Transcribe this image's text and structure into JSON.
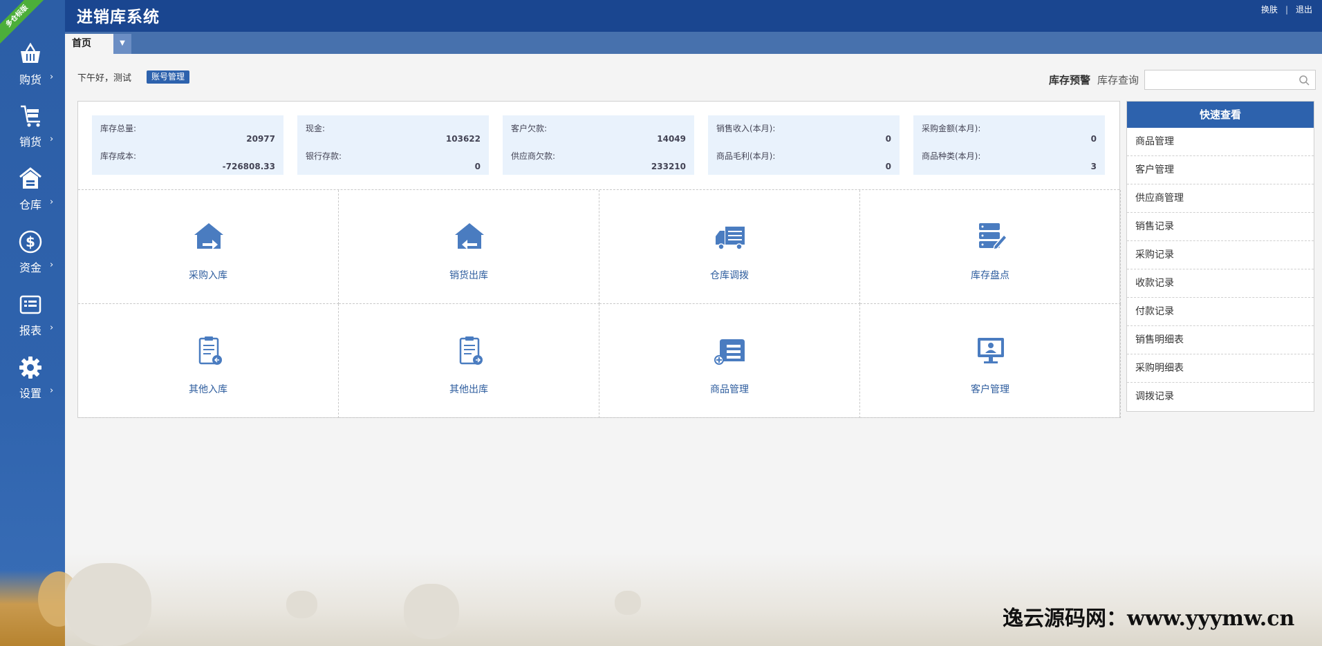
{
  "header": {
    "title": "进销库系统",
    "links": [
      "换肤",
      "退出"
    ]
  },
  "corner_badge": "多仓标版",
  "sidebar": {
    "items": [
      {
        "label": "购货",
        "icon": "basket-icon"
      },
      {
        "label": "销货",
        "icon": "cart-icon"
      },
      {
        "label": "仓库",
        "icon": "warehouse-icon"
      },
      {
        "label": "资金",
        "icon": "dollar-icon"
      },
      {
        "label": "报表",
        "icon": "report-icon"
      },
      {
        "label": "设置",
        "icon": "gear-icon"
      }
    ],
    "chevron": "›"
  },
  "tabs": {
    "home": "首页",
    "dropdown": "▼"
  },
  "greeting": {
    "text": "下午好，测试",
    "account_button": "账号管理"
  },
  "toolbar": {
    "stock_warning": "库存预警",
    "stock_query": "库存查询",
    "search_value": ""
  },
  "stats": [
    {
      "k1": "库存总量:",
      "v1": "20977",
      "k2": "库存成本:",
      "v2": "-726808.33"
    },
    {
      "k1": "现金:",
      "v1": "103622",
      "k2": "银行存款:",
      "v2": "0"
    },
    {
      "k1": "客户欠款:",
      "v1": "14049",
      "k2": "供应商欠款:",
      "v2": "233210"
    },
    {
      "k1": "销售收入(本月):",
      "v1": "0",
      "k2": "商品毛利(本月):",
      "v2": "0"
    },
    {
      "k1": "采购金额(本月):",
      "v1": "0",
      "k2": "商品种类(本月):",
      "v2": "3"
    }
  ],
  "shortcuts": [
    {
      "label": "采购入库",
      "icon": "purchase-in-icon"
    },
    {
      "label": "销货出库",
      "icon": "sales-out-icon"
    },
    {
      "label": "仓库调拨",
      "icon": "truck-icon"
    },
    {
      "label": "库存盘点",
      "icon": "inventory-check-icon"
    },
    {
      "label": "其他入库",
      "icon": "other-in-icon"
    },
    {
      "label": "其他出库",
      "icon": "other-out-icon"
    },
    {
      "label": "商品管理",
      "icon": "product-manage-icon"
    },
    {
      "label": "客户管理",
      "icon": "customer-manage-icon"
    }
  ],
  "quick_view": {
    "title": "快速查看",
    "items": [
      "商品管理",
      "客户管理",
      "供应商管理",
      "销售记录",
      "采购记录",
      "收款记录",
      "付款记录",
      "销售明细表",
      "采购明细表",
      "调拨记录"
    ]
  },
  "watermark": "逸云源码网：www.yyymw.cn",
  "colors": {
    "header_bg": "#1a4690",
    "sidebar_bg": "#2f63ad",
    "accent": "#2d62ad",
    "icon_blue": "#4a7cc0",
    "stat_card_bg": "#e9f2fc"
  }
}
